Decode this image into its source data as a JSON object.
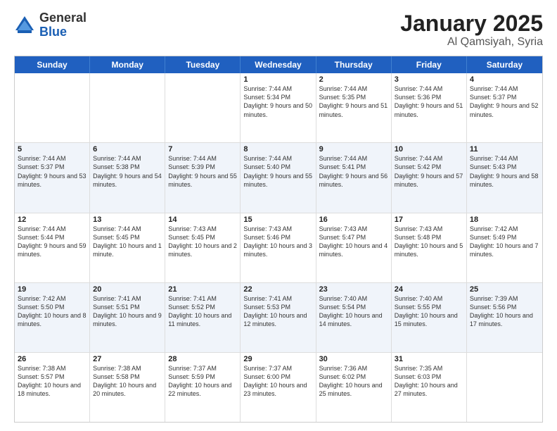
{
  "logo": {
    "general": "General",
    "blue": "Blue"
  },
  "title": {
    "month": "January 2025",
    "location": "Al Qamsiyah, Syria"
  },
  "weekdays": [
    "Sunday",
    "Monday",
    "Tuesday",
    "Wednesday",
    "Thursday",
    "Friday",
    "Saturday"
  ],
  "weeks": [
    [
      {
        "day": "",
        "sunrise": "",
        "sunset": "",
        "daylight": ""
      },
      {
        "day": "",
        "sunrise": "",
        "sunset": "",
        "daylight": ""
      },
      {
        "day": "",
        "sunrise": "",
        "sunset": "",
        "daylight": ""
      },
      {
        "day": "1",
        "sunrise": "Sunrise: 7:44 AM",
        "sunset": "Sunset: 5:34 PM",
        "daylight": "Daylight: 9 hours and 50 minutes."
      },
      {
        "day": "2",
        "sunrise": "Sunrise: 7:44 AM",
        "sunset": "Sunset: 5:35 PM",
        "daylight": "Daylight: 9 hours and 51 minutes."
      },
      {
        "day": "3",
        "sunrise": "Sunrise: 7:44 AM",
        "sunset": "Sunset: 5:36 PM",
        "daylight": "Daylight: 9 hours and 51 minutes."
      },
      {
        "day": "4",
        "sunrise": "Sunrise: 7:44 AM",
        "sunset": "Sunset: 5:37 PM",
        "daylight": "Daylight: 9 hours and 52 minutes."
      }
    ],
    [
      {
        "day": "5",
        "sunrise": "Sunrise: 7:44 AM",
        "sunset": "Sunset: 5:37 PM",
        "daylight": "Daylight: 9 hours and 53 minutes."
      },
      {
        "day": "6",
        "sunrise": "Sunrise: 7:44 AM",
        "sunset": "Sunset: 5:38 PM",
        "daylight": "Daylight: 9 hours and 54 minutes."
      },
      {
        "day": "7",
        "sunrise": "Sunrise: 7:44 AM",
        "sunset": "Sunset: 5:39 PM",
        "daylight": "Daylight: 9 hours and 55 minutes."
      },
      {
        "day": "8",
        "sunrise": "Sunrise: 7:44 AM",
        "sunset": "Sunset: 5:40 PM",
        "daylight": "Daylight: 9 hours and 55 minutes."
      },
      {
        "day": "9",
        "sunrise": "Sunrise: 7:44 AM",
        "sunset": "Sunset: 5:41 PM",
        "daylight": "Daylight: 9 hours and 56 minutes."
      },
      {
        "day": "10",
        "sunrise": "Sunrise: 7:44 AM",
        "sunset": "Sunset: 5:42 PM",
        "daylight": "Daylight: 9 hours and 57 minutes."
      },
      {
        "day": "11",
        "sunrise": "Sunrise: 7:44 AM",
        "sunset": "Sunset: 5:43 PM",
        "daylight": "Daylight: 9 hours and 58 minutes."
      }
    ],
    [
      {
        "day": "12",
        "sunrise": "Sunrise: 7:44 AM",
        "sunset": "Sunset: 5:44 PM",
        "daylight": "Daylight: 9 hours and 59 minutes."
      },
      {
        "day": "13",
        "sunrise": "Sunrise: 7:44 AM",
        "sunset": "Sunset: 5:45 PM",
        "daylight": "Daylight: 10 hours and 1 minute."
      },
      {
        "day": "14",
        "sunrise": "Sunrise: 7:43 AM",
        "sunset": "Sunset: 5:45 PM",
        "daylight": "Daylight: 10 hours and 2 minutes."
      },
      {
        "day": "15",
        "sunrise": "Sunrise: 7:43 AM",
        "sunset": "Sunset: 5:46 PM",
        "daylight": "Daylight: 10 hours and 3 minutes."
      },
      {
        "day": "16",
        "sunrise": "Sunrise: 7:43 AM",
        "sunset": "Sunset: 5:47 PM",
        "daylight": "Daylight: 10 hours and 4 minutes."
      },
      {
        "day": "17",
        "sunrise": "Sunrise: 7:43 AM",
        "sunset": "Sunset: 5:48 PM",
        "daylight": "Daylight: 10 hours and 5 minutes."
      },
      {
        "day": "18",
        "sunrise": "Sunrise: 7:42 AM",
        "sunset": "Sunset: 5:49 PM",
        "daylight": "Daylight: 10 hours and 7 minutes."
      }
    ],
    [
      {
        "day": "19",
        "sunrise": "Sunrise: 7:42 AM",
        "sunset": "Sunset: 5:50 PM",
        "daylight": "Daylight: 10 hours and 8 minutes."
      },
      {
        "day": "20",
        "sunrise": "Sunrise: 7:41 AM",
        "sunset": "Sunset: 5:51 PM",
        "daylight": "Daylight: 10 hours and 9 minutes."
      },
      {
        "day": "21",
        "sunrise": "Sunrise: 7:41 AM",
        "sunset": "Sunset: 5:52 PM",
        "daylight": "Daylight: 10 hours and 11 minutes."
      },
      {
        "day": "22",
        "sunrise": "Sunrise: 7:41 AM",
        "sunset": "Sunset: 5:53 PM",
        "daylight": "Daylight: 10 hours and 12 minutes."
      },
      {
        "day": "23",
        "sunrise": "Sunrise: 7:40 AM",
        "sunset": "Sunset: 5:54 PM",
        "daylight": "Daylight: 10 hours and 14 minutes."
      },
      {
        "day": "24",
        "sunrise": "Sunrise: 7:40 AM",
        "sunset": "Sunset: 5:55 PM",
        "daylight": "Daylight: 10 hours and 15 minutes."
      },
      {
        "day": "25",
        "sunrise": "Sunrise: 7:39 AM",
        "sunset": "Sunset: 5:56 PM",
        "daylight": "Daylight: 10 hours and 17 minutes."
      }
    ],
    [
      {
        "day": "26",
        "sunrise": "Sunrise: 7:38 AM",
        "sunset": "Sunset: 5:57 PM",
        "daylight": "Daylight: 10 hours and 18 minutes."
      },
      {
        "day": "27",
        "sunrise": "Sunrise: 7:38 AM",
        "sunset": "Sunset: 5:58 PM",
        "daylight": "Daylight: 10 hours and 20 minutes."
      },
      {
        "day": "28",
        "sunrise": "Sunrise: 7:37 AM",
        "sunset": "Sunset: 5:59 PM",
        "daylight": "Daylight: 10 hours and 22 minutes."
      },
      {
        "day": "29",
        "sunrise": "Sunrise: 7:37 AM",
        "sunset": "Sunset: 6:00 PM",
        "daylight": "Daylight: 10 hours and 23 minutes."
      },
      {
        "day": "30",
        "sunrise": "Sunrise: 7:36 AM",
        "sunset": "Sunset: 6:02 PM",
        "daylight": "Daylight: 10 hours and 25 minutes."
      },
      {
        "day": "31",
        "sunrise": "Sunrise: 7:35 AM",
        "sunset": "Sunset: 6:03 PM",
        "daylight": "Daylight: 10 hours and 27 minutes."
      },
      {
        "day": "",
        "sunrise": "",
        "sunset": "",
        "daylight": ""
      }
    ]
  ]
}
